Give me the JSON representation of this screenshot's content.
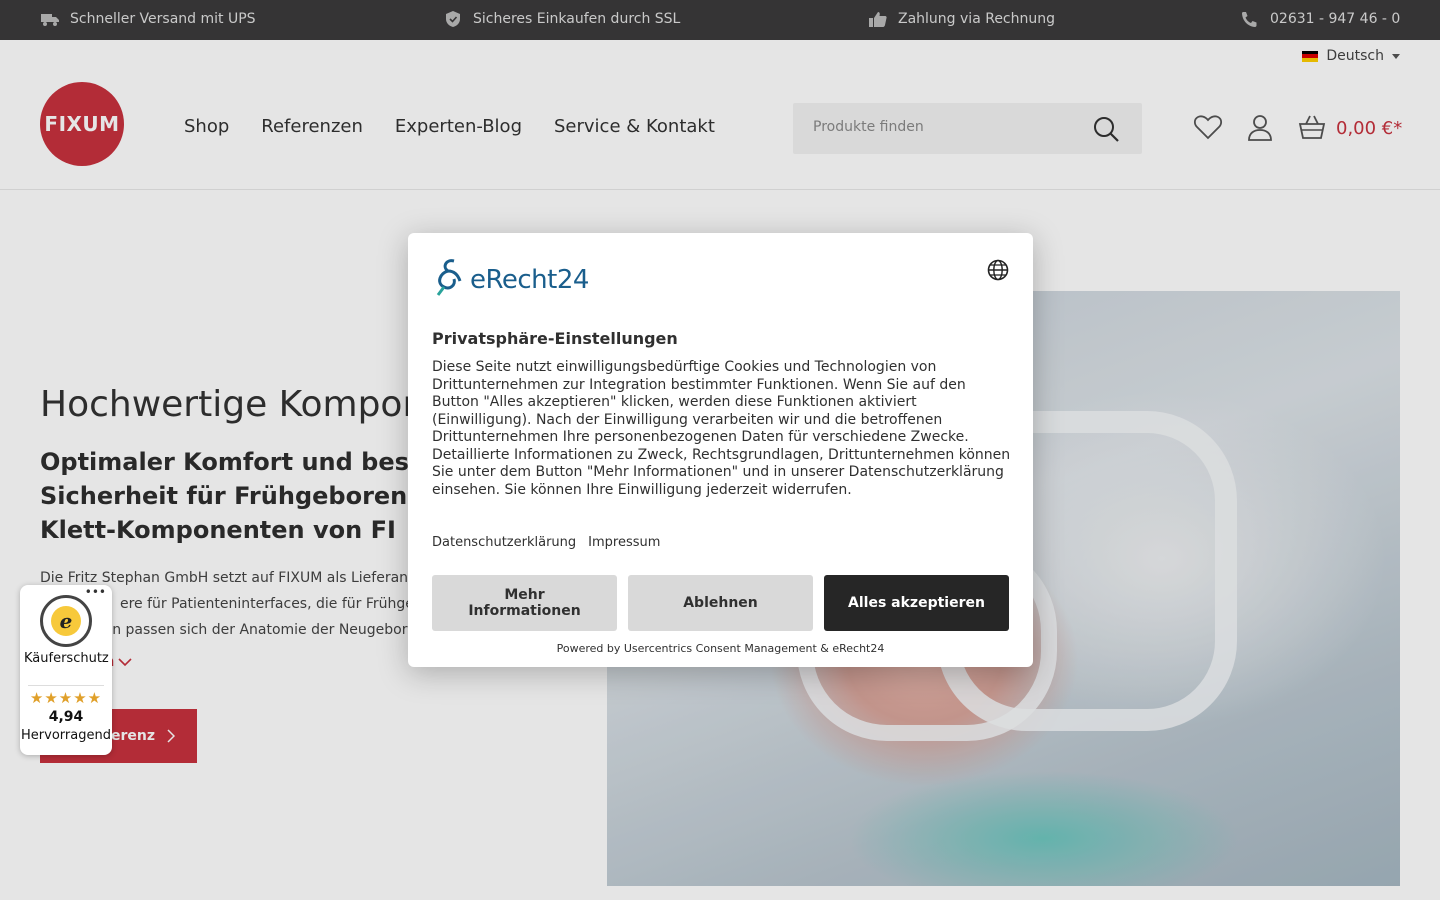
{
  "topbar": {
    "items": [
      {
        "icon": "truck-icon",
        "label": "Schneller Versand mit UPS"
      },
      {
        "icon": "shield-icon",
        "label": "Sicheres Einkaufen durch SSL"
      },
      {
        "icon": "thumbs-up-icon",
        "label": "Zahlung via Rechnung"
      },
      {
        "icon": "phone-icon",
        "label": "02631 - 947 46 - 0"
      }
    ]
  },
  "header": {
    "language": "Deutsch",
    "logo_text": "FIXUM",
    "nav": [
      "Shop",
      "Referenzen",
      "Experten-Blog",
      "Service & Kontakt"
    ],
    "search_placeholder": "Produkte finden",
    "cart_total": "0,00 €*"
  },
  "hero": {
    "title": "Hochwertige Kompone",
    "subtitle": "Optimaler Komfort und bestmö Sicherheit für Frühgeborene du und Klett-Komponenten von FI",
    "text_lines": [
      "Die Fritz Stephan GmbH setzt auf FIXUM als Lieferant",
      "ere für Patienteninterfaces, die für Frühgeb",
      "ken passen sich der Anatomie der Neugebor"
    ],
    "more_link": "gen",
    "cta_label": "erenz"
  },
  "consent": {
    "brand": "eRecht24",
    "title": "Privatsphäre-Einstellungen",
    "body": "Diese Seite nutzt einwilligungsbedürftige Cookies und Technologien von Drittunternehmen zur Integration bestimmter Funktionen. Wenn Sie auf den Button \"Alles akzeptieren\" klicken, werden diese Funktionen aktiviert (Einwilligung). Nach der Einwilligung verarbeiten wir und die betroffenen Drittunternehmen Ihre personenbezogenen Daten für verschiedene Zwecke. Detaillierte Informationen zu Zweck, Rechtsgrundlagen, Drittunternehmen können Sie unter dem Button \"Mehr Informationen\" und in unserer Datenschutzerklärung einsehen. Sie können Ihre Einwilligung jederzeit widerrufen.",
    "links": [
      "Datenschutzerklärung",
      "Impressum"
    ],
    "buttons": {
      "more": "Mehr Informationen",
      "deny": "Ablehnen",
      "accept": "Alles akzeptieren"
    },
    "powered_by": "Powered by Usercentrics Consent Management & eRecht24"
  },
  "trusted_shops": {
    "label": "Käuferschutz",
    "stars": "★★★★★",
    "score": "4,94",
    "rating_text": "Hervorragend"
  },
  "colors": {
    "brand_red": "#c8323e",
    "topbar_bg": "#3b3a3b",
    "accept_bg": "#262626",
    "secondary_btn_bg": "#d9d9d9",
    "erecht_blue": "#1a5e8c"
  }
}
